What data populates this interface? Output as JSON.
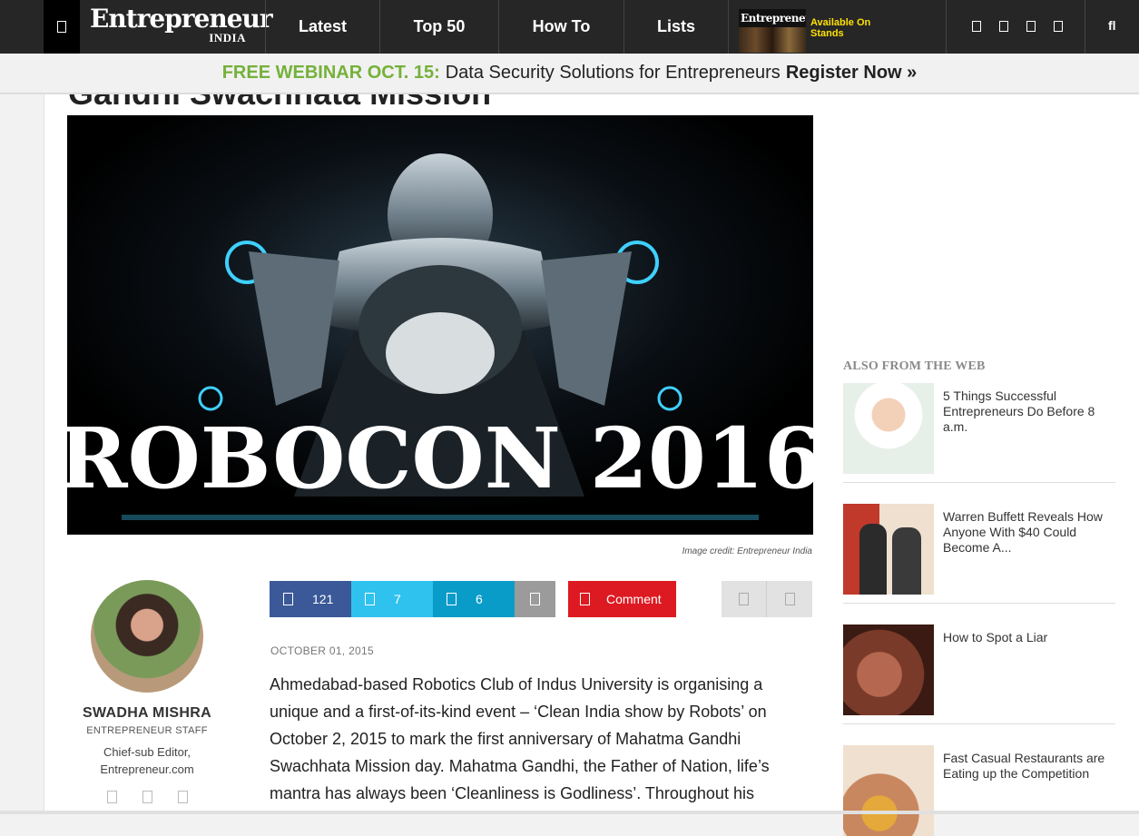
{
  "nav": {
    "logo_word": "Entrepreneur",
    "logo_sub": "INDIA",
    "items": [
      {
        "label": "Latest"
      },
      {
        "label": "Top 50"
      },
      {
        "label": "How To"
      },
      {
        "label": "Lists"
      }
    ],
    "magazine_title": "Entrepreneur",
    "available_line1": "Available On",
    "available_line2": "Stands",
    "search_glyph": "fl"
  },
  "banner": {
    "highlight": "FREE WEBINAR OCT. 15:",
    "text": "Data Security Solutions for Entrepreneurs",
    "cta": "Register Now »"
  },
  "article": {
    "title_partial": "Gandhi Swachhata Mission",
    "hero_text": "ROBOCON 2016",
    "image_credit": "Image credit: Entrepreneur India",
    "date": "OCTOBER 01, 2015",
    "body": "Ahmedabad-based Robotics Club of Indus University is organising a unique and a first-of-its-kind event – ‘Clean India show by Robots’ on October 2, 2015 to mark the first anniversary of Mahatma Gandhi Swachhata Mission day. Mahatma Gandhi, the Father of Nation, life’s mantra has always been ‘Cleanliness is Godliness’. Throughout his"
  },
  "author": {
    "name": "SWADHA MISHRA",
    "staff": "ENTREPRENEUR STAFF",
    "role_line1": "Chief-sub Editor,",
    "role_line2": "Entrepreneur.com"
  },
  "share": {
    "facebook_count": "121",
    "twitter_count": "7",
    "linkedin_count": "6",
    "comment_label": "Comment"
  },
  "sidebar": {
    "heading": "ALSO FROM THE WEB",
    "items": [
      {
        "title": "5 Things Successful Entrepreneurs Do Before 8 a.m."
      },
      {
        "title": "Warren Buffett Reveals How Anyone With $40 Could Become A..."
      },
      {
        "title": "How to Spot a Liar"
      },
      {
        "title": "Fast Casual Restaurants are Eating up the Competition"
      }
    ]
  },
  "colors": {
    "nav_bg": "#262626",
    "banner_green": "#75b13a",
    "facebook": "#3b5998",
    "twitter": "#2fc2ef",
    "linkedin": "#0a9cc9",
    "comment": "#dd1a22"
  }
}
